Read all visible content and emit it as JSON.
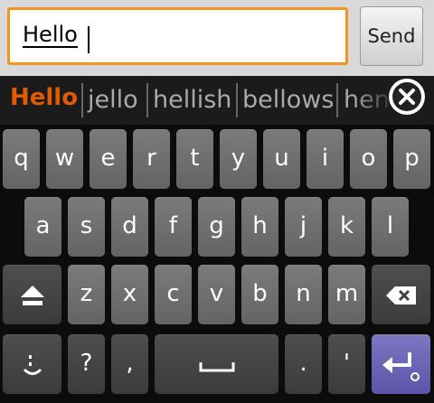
{
  "compose": {
    "input_value": "Hello",
    "send_label": "Send"
  },
  "suggestions": [
    "Hello",
    "jello",
    "hellish",
    "bellows",
    "hen"
  ],
  "keyboard": {
    "row1": [
      "q",
      "w",
      "e",
      "r",
      "t",
      "y",
      "u",
      "i",
      "o",
      "p"
    ],
    "row2": [
      "a",
      "s",
      "d",
      "f",
      "g",
      "h",
      "j",
      "k",
      "l"
    ],
    "row3": [
      "z",
      "x",
      "c",
      "v",
      "b",
      "n",
      "m"
    ],
    "bottom": {
      "question": "?",
      "comma": ",",
      "period": ".",
      "apostrophe": "'"
    }
  },
  "icons": {
    "shift": "shift-icon",
    "backspace": "backspace-icon",
    "emoji": "smiley-icon",
    "space": "space-icon",
    "enter": "enter-icon",
    "close": "close-icon"
  },
  "colors": {
    "accent": "#f0931f",
    "suggestion_highlight": "#e05a00",
    "enter_key": "#6a63b6"
  }
}
